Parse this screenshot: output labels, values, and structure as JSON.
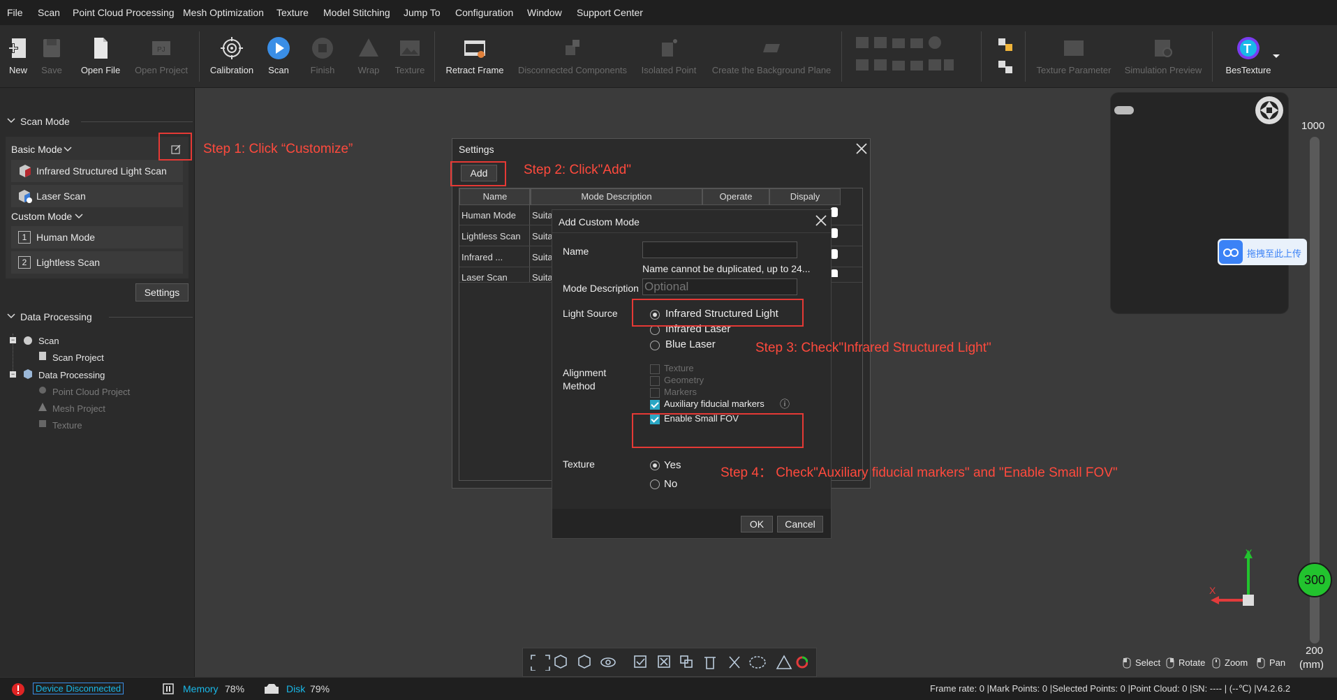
{
  "menu": [
    "File",
    "Scan",
    "Point Cloud Processing",
    "Mesh Optimization",
    "Texture",
    "Model Stitching",
    "Jump To",
    "Configuration",
    "Window",
    "Support Center"
  ],
  "toolbar": {
    "new": "New",
    "save": "Save",
    "open_file": "Open File",
    "open_project": "Open Project",
    "calibration": "Calibration",
    "scan": "Scan",
    "finish": "Finish",
    "wrap": "Wrap",
    "texture": "Texture",
    "retract_frame": "Retract Frame",
    "disconnected_components": "Disconnected Components",
    "isolated_point": "Isolated Point",
    "create_bg_plane": "Create the Background Plane",
    "texture_parameter": "Texture Parameter",
    "simulation_preview": "Simulation Preview",
    "bestexture": "BesTexture"
  },
  "left_panel": {
    "scan_mode_title": "Scan Mode",
    "basic_mode": "Basic Mode",
    "basic_items": [
      "Infrared Structured Light Scan",
      "Laser Scan"
    ],
    "custom_mode": "Custom Mode",
    "custom_items": [
      {
        "num": "1",
        "label": "Human Mode"
      },
      {
        "num": "2",
        "label": "Lightless Scan"
      }
    ],
    "settings_button": "Settings",
    "data_processing_title": "Data Processing",
    "tree": [
      {
        "label": "Scan",
        "dim": false
      },
      {
        "label": "Scan Project",
        "dim": false
      },
      {
        "label": "Data Processing",
        "dim": false
      },
      {
        "label": "Point Cloud Project",
        "dim": true
      },
      {
        "label": "Mesh Project",
        "dim": true
      },
      {
        "label": "Texture",
        "dim": true
      }
    ]
  },
  "settings_dialog": {
    "title": "Settings",
    "add_button": "Add",
    "columns": [
      "Name",
      "Mode Description",
      "Operate",
      "Dispaly"
    ],
    "rows": [
      {
        "name": "Human Mode",
        "desc": "Suital"
      },
      {
        "name": "Lightless Scan",
        "desc": "Suital"
      },
      {
        "name": "Infrared ...",
        "desc": "Suital"
      },
      {
        "name": "Laser Scan",
        "desc": "Suital"
      }
    ]
  },
  "custom_dialog": {
    "title": "Add Custom Mode",
    "name_label": "Name",
    "name_value": "",
    "name_hint": "Name cannot be duplicated, up to 24...",
    "desc_label": "Mode Description",
    "desc_placeholder": "Optional",
    "light_source_label": "Light Source",
    "light_options": [
      {
        "label": "Infrared Structured Light",
        "selected": true
      },
      {
        "label": "Infrared Laser",
        "selected": false
      },
      {
        "label": "Blue Laser",
        "selected": false
      }
    ],
    "alignment_label_1": "Alignment",
    "alignment_label_2": "Method",
    "alignment_options": [
      {
        "label": "Texture",
        "checked": false,
        "enabled": false
      },
      {
        "label": "Geometry",
        "checked": false,
        "enabled": false
      },
      {
        "label": "Markers",
        "checked": false,
        "enabled": false
      },
      {
        "label": "Auxiliary fiducial markers",
        "checked": true,
        "enabled": true
      },
      {
        "label": "Enable Small FOV",
        "checked": true,
        "enabled": true
      }
    ],
    "info_glyph": "ⓘ",
    "texture_label": "Texture",
    "texture_options": [
      {
        "label": "Yes",
        "selected": true
      },
      {
        "label": "No",
        "selected": false
      }
    ],
    "ok": "OK",
    "cancel": "Cancel"
  },
  "steps": {
    "step1": "Step 1: Click  “Customize”",
    "step2": "Step 2: Click\"Add\"",
    "step3": "Step 3: Check\"Infrared Structured Light\"",
    "step4": "Step 4：  Check\"Auxiliary fiducial markers\" and \"Enable Small FOV\""
  },
  "viewport": {
    "upload_tag": "拖拽至此上传",
    "distance_max": "1000",
    "distance_current": "300",
    "distance_min": "200",
    "distance_unit": "(mm)",
    "axis_x": "X",
    "axis_y": "Y",
    "mouse_hints": [
      "Select",
      "Rotate",
      "Zoom",
      "Pan"
    ]
  },
  "status": {
    "device": "Device Disconnected",
    "memory_label": "Memory",
    "memory_value": "78%",
    "disk_label": "Disk",
    "disk_value": "79%",
    "right": "Frame rate: 0 |Mark Points: 0 |Selected Points: 0 |Point Cloud: 0 |SN: ---- | (--℃) |V4.2.6.2"
  },
  "colors": {
    "accent": "#2aa7c4",
    "step_red": "#ff4a3d",
    "highlight_box": "#e53935",
    "distance_green": "#22c32e"
  }
}
